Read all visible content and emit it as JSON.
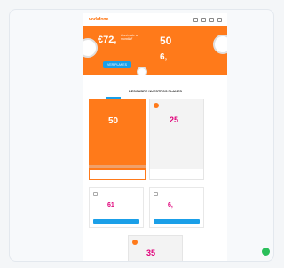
{
  "header": {
    "logo": "vodafone",
    "icons": [
      "search-icon",
      "user-icon",
      "cart-icon",
      "menu-icon"
    ]
  },
  "hero": {
    "headline": "€72,",
    "subline": "",
    "tagline": "Conéctate al mundial!",
    "price1": "50",
    "price2": "6,",
    "cta": "VER PLANES"
  },
  "section": {
    "title": "DESCUBRE NUESTROS PLANES",
    "subtitle": ""
  },
  "plans_row1": [
    {
      "price": "50",
      "sub": "",
      "footer": ""
    },
    {
      "name": "",
      "price": "25",
      "sub": "",
      "footer": ""
    }
  ],
  "plans_row2": [
    {
      "name": "",
      "price": "61"
    },
    {
      "name": "",
      "price": "6,"
    }
  ],
  "plan_last": {
    "name": "",
    "price": "35"
  },
  "colors": {
    "accent": "#ff7a1a",
    "brand_blue": "#1a9fe8",
    "price_pink": "#e0007a",
    "chat": "#2bbf5a"
  }
}
